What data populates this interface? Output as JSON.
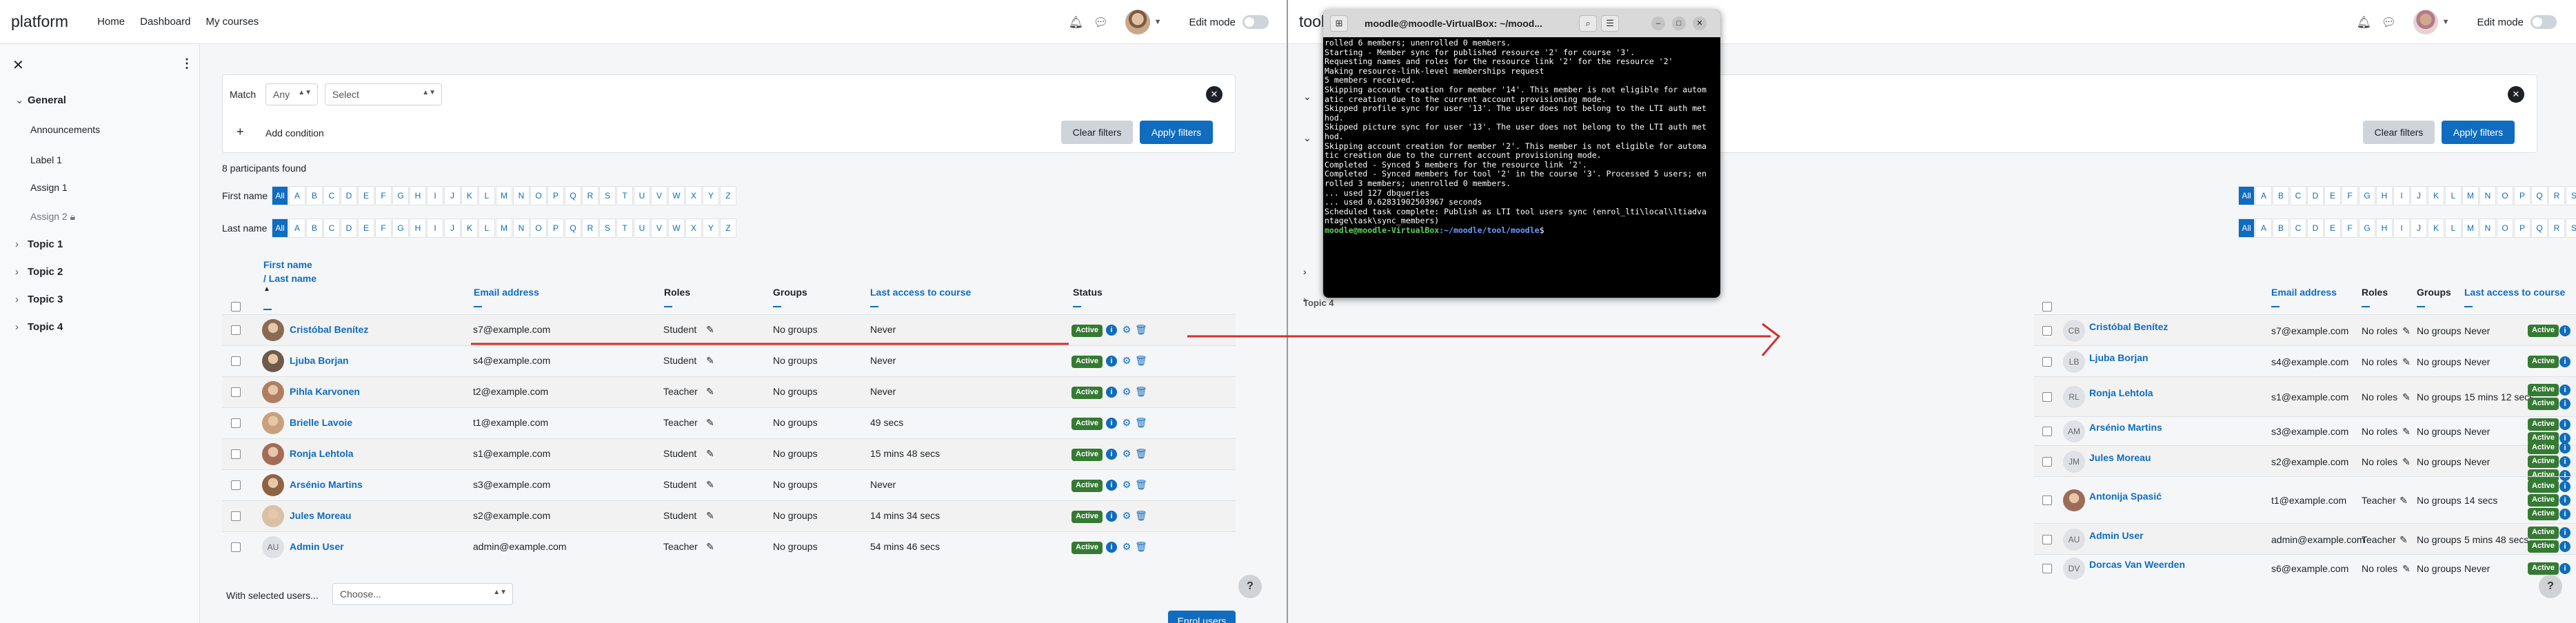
{
  "brand": "platform",
  "nav": [
    "Home",
    "Dashboard",
    "My courses"
  ],
  "right_brand": "tool",
  "edit_mode": "Edit mode",
  "drawer": {
    "sections": [
      {
        "label": "General",
        "items": [
          "Announcements",
          "Label 1",
          "Assign 1",
          "Assign 2"
        ]
      },
      {
        "label": "Topic 1"
      },
      {
        "label": "Topic 2"
      },
      {
        "label": "Topic 3"
      },
      {
        "label": "Topic 4"
      }
    ]
  },
  "right_topic4": "Topic 4",
  "filters": {
    "match_label": "Match",
    "match_value": "Any",
    "select_placeholder": "Select",
    "add_condition": "Add condition",
    "clear": "Clear filters",
    "apply": "Apply filters"
  },
  "participants_found": "8 participants found",
  "initials": {
    "first_label": "First name",
    "last_label": "Last name",
    "all": "All",
    "letters": [
      "A",
      "B",
      "C",
      "D",
      "E",
      "F",
      "G",
      "H",
      "I",
      "J",
      "K",
      "L",
      "M",
      "N",
      "O",
      "P",
      "Q",
      "R",
      "S",
      "T",
      "U",
      "V",
      "W",
      "X",
      "Y",
      "Z"
    ]
  },
  "columns": {
    "first": "First name",
    "last": "/ Last name",
    "email": "Email address",
    "roles": "Roles",
    "groups": "Groups",
    "access": "Last access to course",
    "status": "Status"
  },
  "left_rows": [
    {
      "name": "Cristóbal Benítez",
      "email": "s7@example.com",
      "role": "Student",
      "groups": "No groups",
      "access": "Never",
      "status": "Active"
    },
    {
      "name": "Ljuba Borjan",
      "email": "s4@example.com",
      "role": "Student",
      "groups": "No groups",
      "access": "Never",
      "status": "Active"
    },
    {
      "name": "Pihla Karvonen",
      "email": "t2@example.com",
      "role": "Teacher",
      "groups": "No groups",
      "access": "Never",
      "status": "Active"
    },
    {
      "name": "Brielle Lavoie",
      "email": "t1@example.com",
      "role": "Teacher",
      "groups": "No groups",
      "access": "49 secs",
      "status": "Active"
    },
    {
      "name": "Ronja Lehtola",
      "email": "s1@example.com",
      "role": "Student",
      "groups": "No groups",
      "access": "15 mins 48 secs",
      "status": "Active"
    },
    {
      "name": "Arsénio Martins",
      "email": "s3@example.com",
      "role": "Student",
      "groups": "No groups",
      "access": "Never",
      "status": "Active"
    },
    {
      "name": "Jules Moreau",
      "email": "s2@example.com",
      "role": "Student",
      "groups": "No groups",
      "access": "14 mins 34 secs",
      "status": "Active"
    },
    {
      "name": "Admin User",
      "email": "admin@example.com",
      "role": "Teacher",
      "groups": "No groups",
      "access": "54 mins 46 secs",
      "status": "Active",
      "initials": "AU"
    }
  ],
  "right_rows": [
    {
      "name": "Cristóbal Benítez",
      "email": "s7@example.com",
      "role": "No roles",
      "groups": "No groups",
      "access": "Never",
      "initials": "CB"
    },
    {
      "name": "Ljuba Borjan",
      "email": "s4@example.com",
      "role": "No roles",
      "groups": "No groups",
      "access": "Never",
      "initials": "LB"
    },
    {
      "name": "Ronja Lehtola",
      "email": "s1@example.com",
      "role": "No roles",
      "groups": "No groups",
      "access": "15 mins 12 secs",
      "initials": "RL"
    },
    {
      "name": "Arsénio Martins",
      "email": "s3@example.com",
      "role": "No roles",
      "groups": "No groups",
      "access": "Never",
      "initials": "AM"
    },
    {
      "name": "Jules Moreau",
      "email": "s2@example.com",
      "role": "No roles",
      "groups": "No groups",
      "access": "Never",
      "initials": "JM"
    },
    {
      "name": "Antonija Spasić",
      "email": "t1@example.com",
      "role": "Teacher",
      "groups": "No groups",
      "access": "14 secs"
    },
    {
      "name": "Admin User",
      "email": "admin@example.com",
      "role": "Teacher",
      "groups": "No groups",
      "access": "5 mins 48 secs",
      "initials": "AU"
    },
    {
      "name": "Dorcas Van Weerden",
      "email": "s6@example.com",
      "role": "No roles",
      "groups": "No groups",
      "access": "Never",
      "initials": "DV"
    }
  ],
  "status_active": "Active",
  "bulk": {
    "label": "With selected users...",
    "placeholder": "Choose..."
  },
  "enrol_button": "Enrol users",
  "help": "?",
  "terminal": {
    "title": "moodle@moodle-VirtualBox: ~/mood...",
    "lines": [
      "rolled 6 members; unenrolled 0 members.",
      "",
      "Starting - Member sync for published resource '2' for course '3'.",
      "Requesting names and roles for the resource link '2' for the resource '2'",
      "Making resource-link-level memberships request",
      "5 members received.",
      "Skipping account creation for member '14'. This member is not eligible for autom",
      "atic creation due to the current account provisioning mode.",
      "Skipped profile sync for user '13'. The user does not belong to the LTI auth met",
      "hod.",
      "Skipped picture sync for user '13'. The user does not belong to the LTI auth met",
      "hod.",
      "Skipping account creation for member '2'. This member is not eligible for automa",
      "tic creation due to the current account provisioning mode.",
      "Completed - Synced 5 members for the resource link '2'.",
      "",
      "Completed - Synced members for tool '2' in the course '3'. Processed 5 users; en",
      "rolled 3 members; unenrolled 0 members.",
      "",
      "... used 127 dbqueries",
      "... used 0.62831902503967 seconds",
      "Scheduled task complete: Publish as LTI tool users sync (enrol_lti\\local\\ltiadva",
      "ntage\\task\\sync_members)"
    ],
    "prompt_user": "moodle@moodle-VirtualBox",
    "prompt_path": ":~/moodle/tool/moodle",
    "prompt_end": "$"
  }
}
